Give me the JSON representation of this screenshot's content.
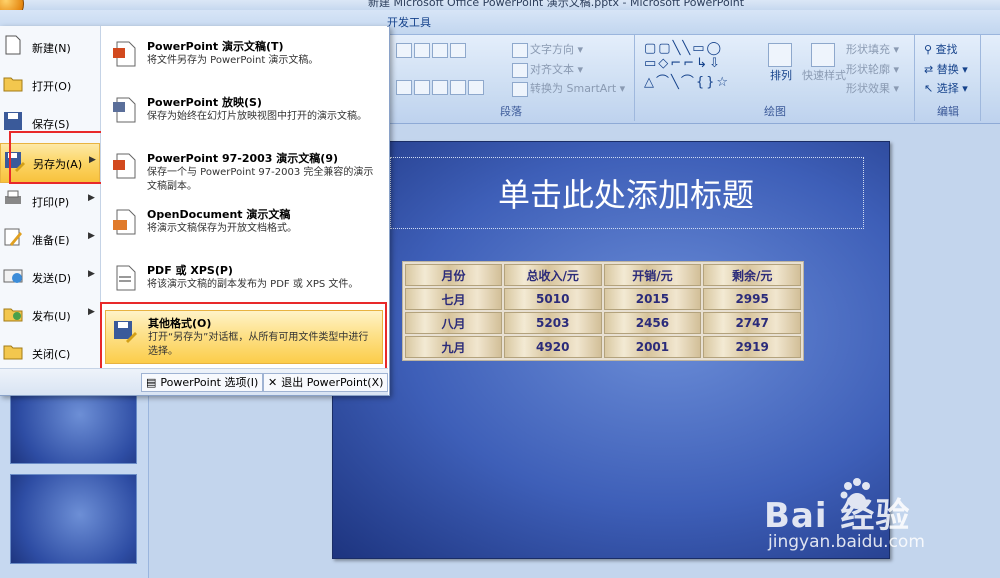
{
  "window": {
    "title": "新建 Microsoft Office PowerPoint 演示文稿.pptx - Microsoft PowerPoint"
  },
  "ribbon": {
    "tab_visible": "开发工具",
    "groups": {
      "paragraph": {
        "label": "段落",
        "text_direction": "文字方向",
        "align_text": "对齐文本",
        "smartart": "转换为 SmartArt"
      },
      "drawing": {
        "label": "绘图",
        "arrange": "排列",
        "quick_styles": "快速样式",
        "shape_fill": "形状填充",
        "shape_outline": "形状轮廓",
        "shape_effects": "形状效果"
      },
      "editing": {
        "label": "编辑",
        "find": "查找",
        "replace": "替换",
        "select": "选择"
      }
    }
  },
  "office_menu": {
    "items": [
      {
        "label": "新建(N)"
      },
      {
        "label": "打开(O)"
      },
      {
        "label": "保存(S)"
      },
      {
        "label": "另存为(A)"
      },
      {
        "label": "打印(P)"
      },
      {
        "label": "准备(E)"
      },
      {
        "label": "发送(D)"
      },
      {
        "label": "发布(U)"
      },
      {
        "label": "关闭(C)"
      }
    ],
    "save_as_options": [
      {
        "title": "PowerPoint 演示文稿(T)",
        "desc": "将文件另存为 PowerPoint 演示文稿。"
      },
      {
        "title": "PowerPoint 放映(S)",
        "desc": "保存为始终在幻灯片放映视图中打开的演示文稿。"
      },
      {
        "title": "PowerPoint 97-2003 演示文稿(9)",
        "desc": "保存一个与 PowerPoint 97-2003 完全兼容的演示文稿副本。"
      },
      {
        "title": "OpenDocument 演示文稿",
        "desc": "将演示文稿保存为开放文档格式。"
      },
      {
        "title": "PDF 或 XPS(P)",
        "desc": "将该演示文稿的副本发布为 PDF 或 XPS 文件。"
      },
      {
        "title": "其他格式(O)",
        "desc": "打开“另存为”对话框，从所有可用文件类型中进行选择。"
      }
    ],
    "options_button": "PowerPoint 选项(I)",
    "exit_button": "退出 PowerPoint(X)"
  },
  "slide": {
    "title_placeholder": "单击此处添加标题",
    "table": {
      "headers": [
        "月份",
        "总收入/元",
        "开销/元",
        "剩余/元"
      ],
      "rows": [
        [
          "七月",
          "5010",
          "2015",
          "2995"
        ],
        [
          "八月",
          "5203",
          "2456",
          "2747"
        ],
        [
          "九月",
          "4920",
          "2001",
          "2919"
        ]
      ]
    }
  },
  "watermark": {
    "brand": "Bai 经验",
    "url": "jingyan.baidu.com"
  },
  "colors": {
    "highlight": "#fbd565",
    "annotation_box": "#e8292a",
    "slide_bg": "#3e5fb8"
  }
}
